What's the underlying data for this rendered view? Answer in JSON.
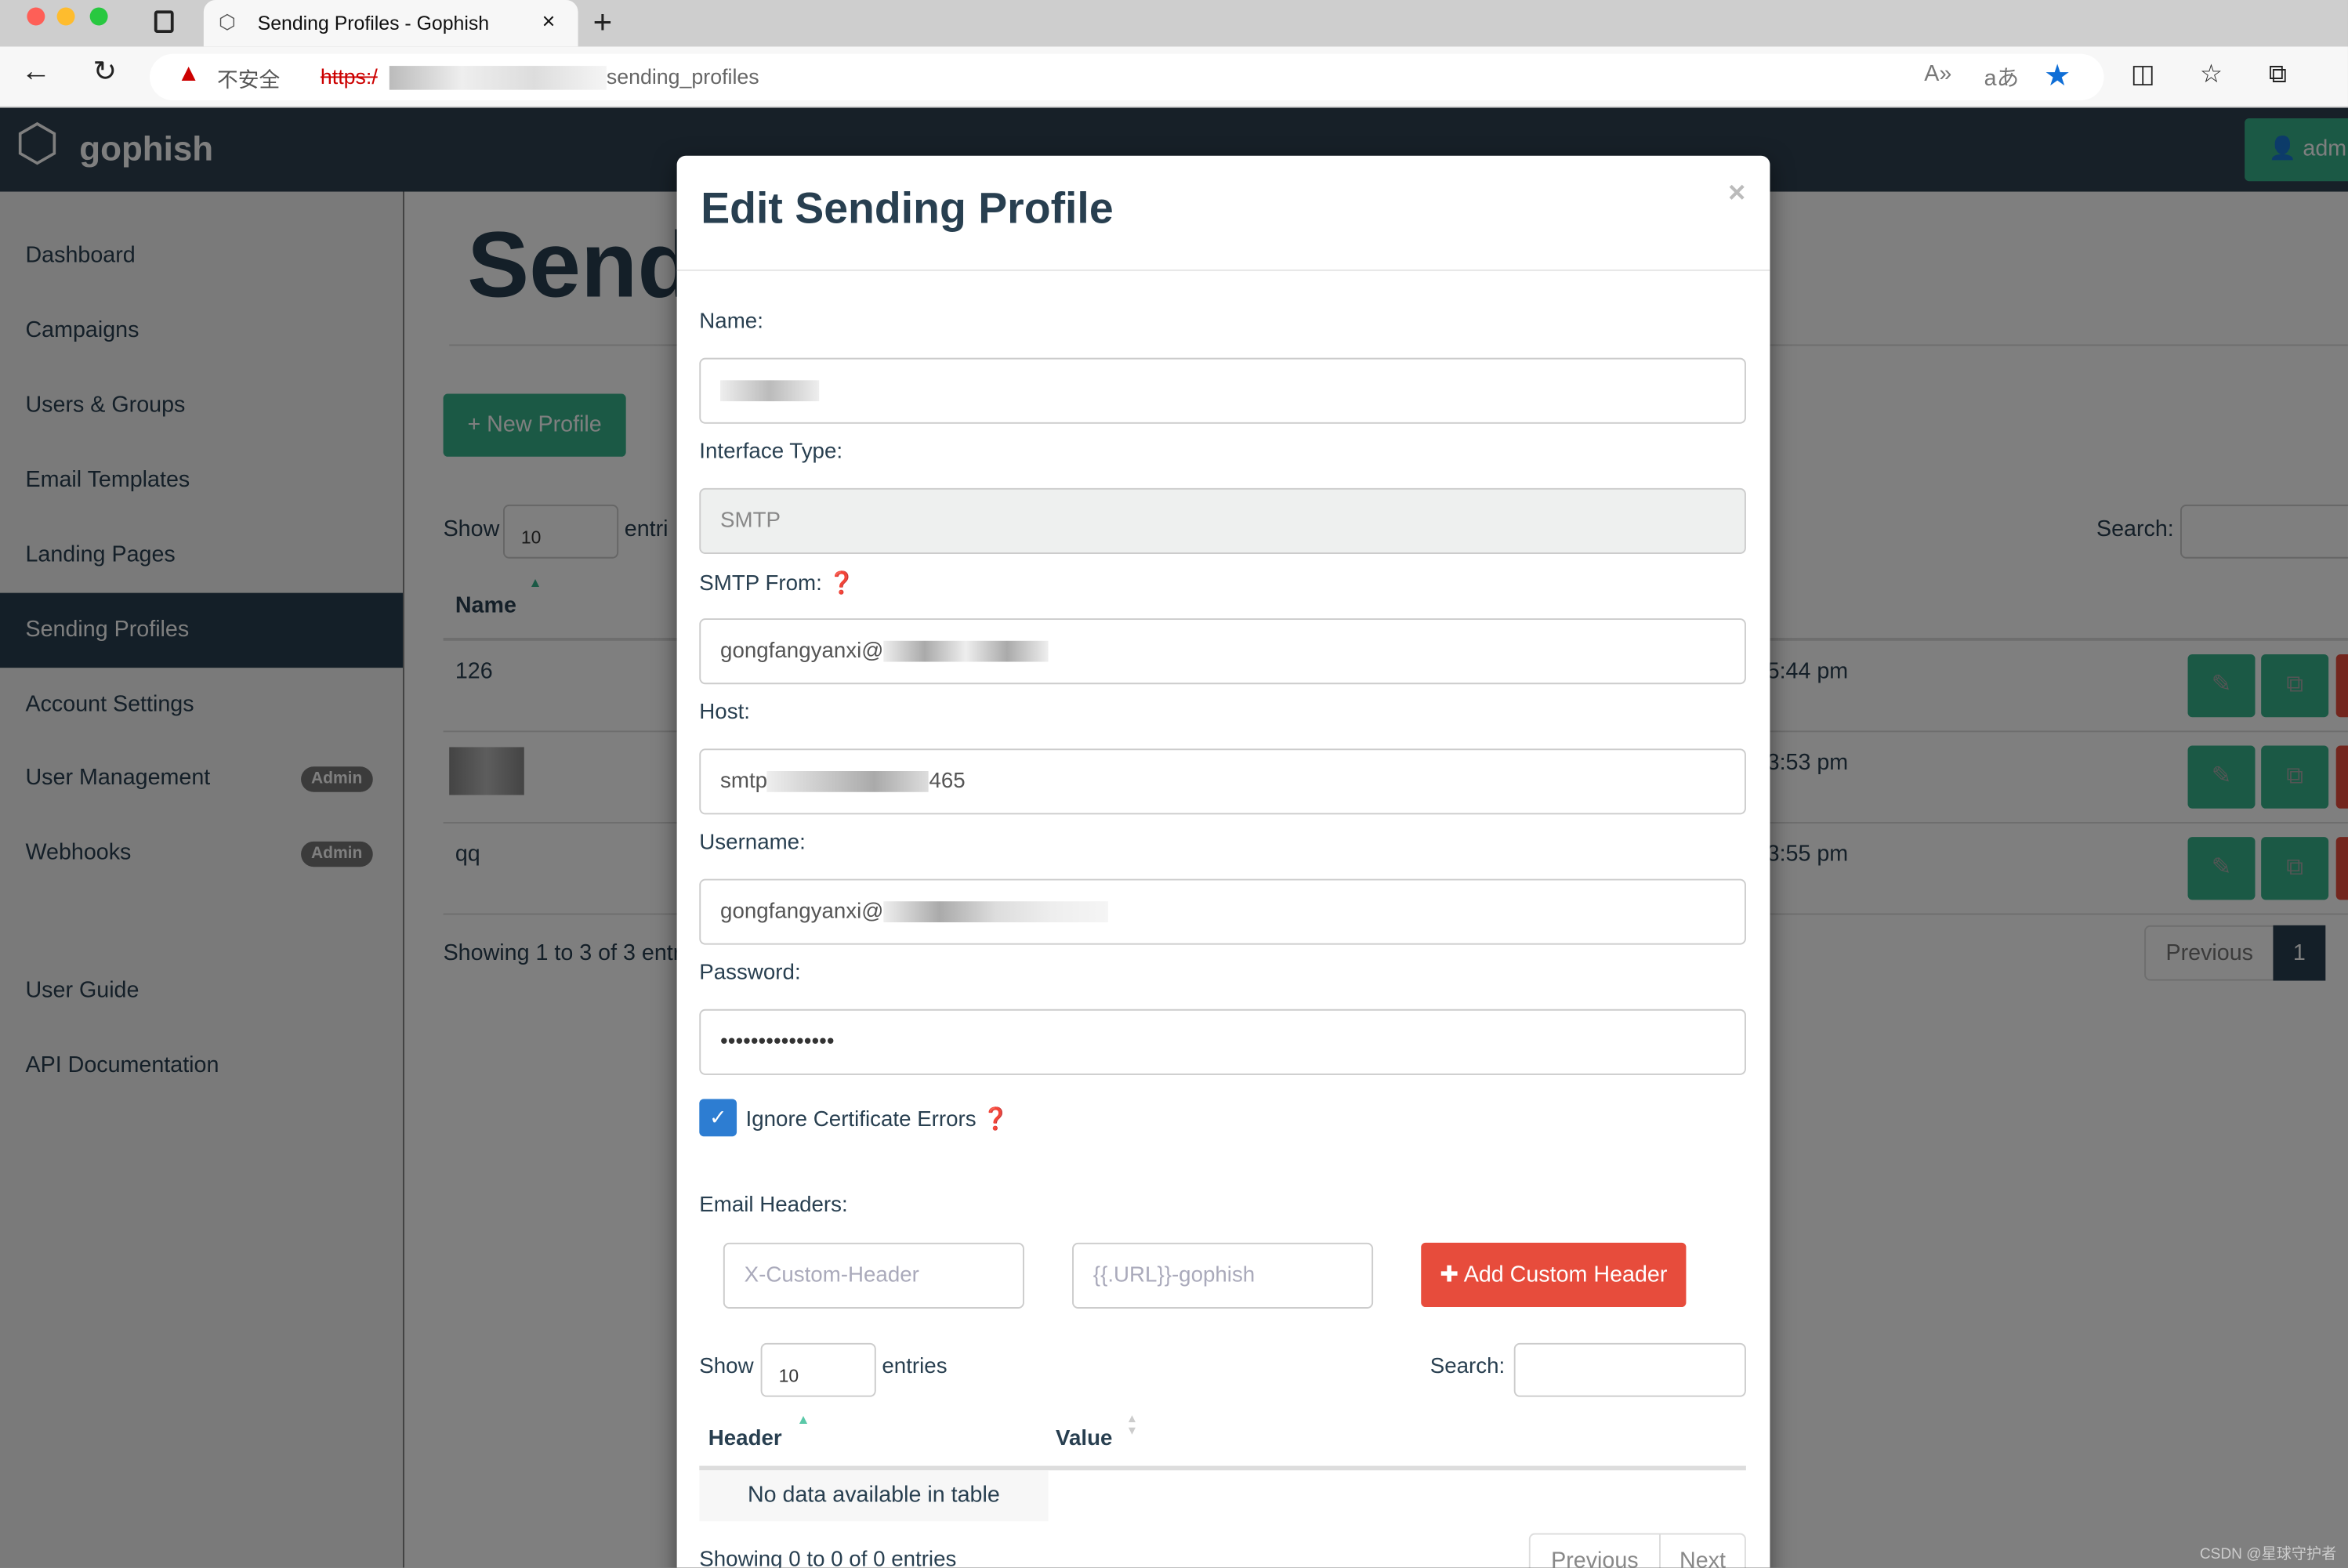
{
  "browser": {
    "tab_title": "Sending Profiles - Gophish",
    "security_label": "不安全",
    "url_scheme": "https:/",
    "url_path": "sending_profiles",
    "star_color": "#0f6ed6"
  },
  "navbar": {
    "brand": "gophish",
    "user": "admin"
  },
  "sidebar": {
    "items": [
      {
        "label": "Dashboard"
      },
      {
        "label": "Campaigns"
      },
      {
        "label": "Users & Groups"
      },
      {
        "label": "Email Templates"
      },
      {
        "label": "Landing Pages"
      },
      {
        "label": "Sending Profiles",
        "active": true
      },
      {
        "label": "Account Settings"
      },
      {
        "label": "User Management",
        "badge": "Admin"
      },
      {
        "label": "Webhooks",
        "badge": "Admin"
      },
      {
        "label": "User Guide"
      },
      {
        "label": "API Documentation"
      }
    ]
  },
  "page": {
    "title": "Send",
    "new_button": "New Profile",
    "show_label": "Show",
    "show_value": "10",
    "entries_label": "entri",
    "search_label": "Search:",
    "col_name": "Name",
    "rows": [
      {
        "name": "126",
        "date": "5:44 pm"
      },
      {
        "name": "",
        "date": "3:53 pm"
      },
      {
        "name": "qq",
        "date": "3:55 pm"
      }
    ],
    "showing": "Showing 1 to 3 of 3 entri",
    "prev": "Previous",
    "page": "1"
  },
  "modal": {
    "title": "Edit Sending Profile",
    "close": "×",
    "name_label": "Name:",
    "interface_label": "Interface Type:",
    "interface_value": "SMTP",
    "from_label": "SMTP From:",
    "from_value": "gongfangyanxi@",
    "host_label": "Host:",
    "host_prefix": "smtp",
    "host_suffix": "465",
    "username_label": "Username:",
    "username_value": "gongfangyanxi@",
    "password_label": "Password:",
    "password_value": "•••••••••••••••",
    "ignore_label": "Ignore Certificate Errors",
    "ignore_checked": true,
    "headers_label": "Email Headers:",
    "header_placeholder": "X-Custom-Header",
    "value_placeholder": "{{.URL}}-gophish",
    "add_header": "Add Custom Header",
    "show_label": "Show",
    "show_value": "10",
    "entries_label": "entries",
    "search_label": "Search:",
    "col_header": "Header",
    "col_value": "Value",
    "empty": "No data available in table",
    "showing": "Showing 0 to 0 of 0 entries",
    "prev": "Previous",
    "next": "Next"
  },
  "watermark": "CSDN @星球守护者"
}
